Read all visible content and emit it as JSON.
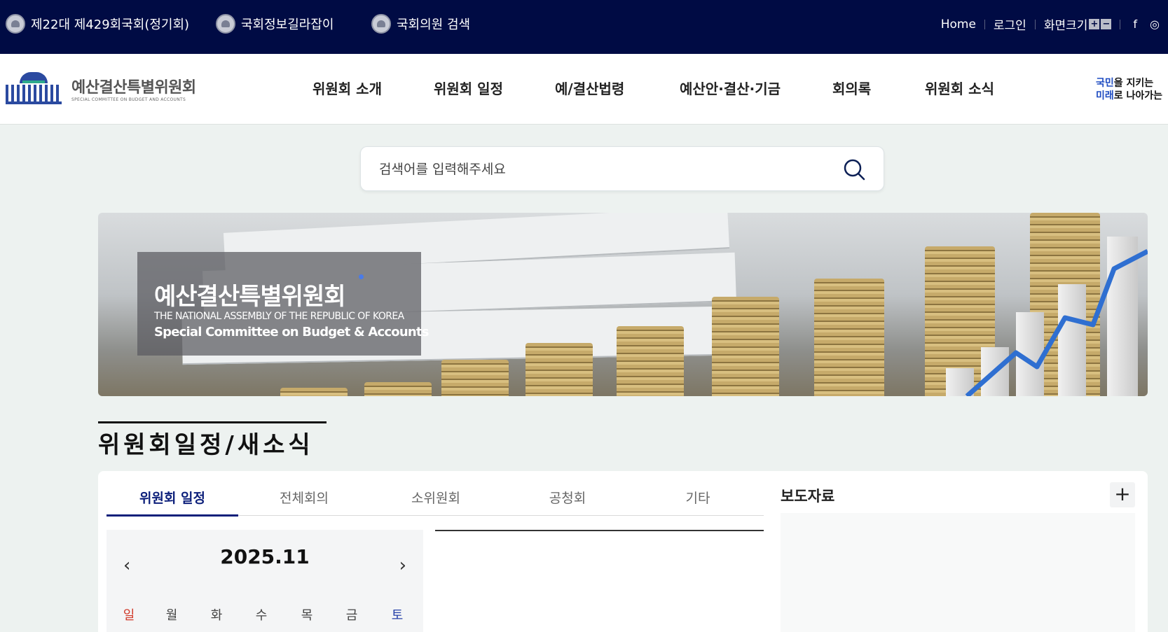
{
  "topbar": {
    "links": [
      {
        "label": "제22대 제429회국회(정기회)"
      },
      {
        "label": "국회정보길라잡이"
      },
      {
        "label": "국회의원 검색"
      }
    ],
    "home": "Home",
    "login": "로그인",
    "zoom_label": "화면크기",
    "zoom_in": "+",
    "zoom_out": "−",
    "social_facebook": "f",
    "social_instagram": "◎"
  },
  "header": {
    "logo_ko": "예산결산특별위원회",
    "logo_en": "SPECIAL COMMITTEE ON BUDGET AND ACCOUNTS",
    "nav": [
      "위원회 소개",
      "위원회 일정",
      "예/결산법령",
      "예산안·결산·기금",
      "회의록",
      "위원회 소식"
    ],
    "slogan_line1_hl": "국민",
    "slogan_line1": "을 지키는",
    "slogan_line2_hl": "미래",
    "slogan_line2": "로 나아가는"
  },
  "search": {
    "placeholder": "검색어를 입력해주세요"
  },
  "banner": {
    "title": "예산결산특별위원회",
    "subtitle1": "THE NATIONAL ASSEMBLY OF THE REPUBLIC OF KOREA",
    "subtitle2": "Special Committee on Budget & Accounts"
  },
  "section": {
    "title": "위원회일정/새소식"
  },
  "schedule": {
    "tabs": [
      "위원회 일정",
      "전체회의",
      "소위원회",
      "공청회",
      "기타"
    ],
    "active_tab": 0,
    "calendar": {
      "month": "2025.11",
      "prev": "‹",
      "next": "›",
      "weekdays": [
        "일",
        "월",
        "화",
        "수",
        "목",
        "금",
        "토"
      ]
    }
  },
  "press": {
    "title": "보도자료",
    "more": "+"
  },
  "colors": {
    "topbar_bg": "#000b44",
    "accent": "#0c1f7a",
    "sunday": "#d13b2b",
    "saturday": "#2540a8"
  }
}
